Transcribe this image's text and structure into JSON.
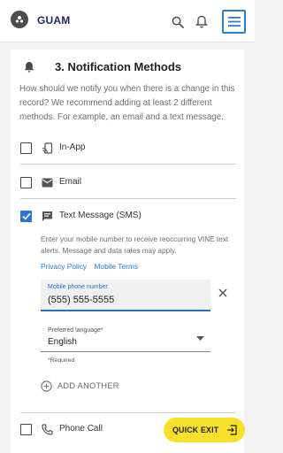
{
  "header": {
    "brand": "GUAM",
    "logo_icon": "vine-logo-icon",
    "search_icon": "search-icon",
    "notifications_icon": "bell-icon",
    "menu_icon": "menu-icon"
  },
  "section": {
    "title": "3. Notification Methods",
    "description": "How should we notify you when there is a change in this record? We recommend adding at least 2 different methods. For example, an email and a text message."
  },
  "methods": [
    {
      "label": "In-App",
      "icon": "cast-device-icon",
      "checked": false
    },
    {
      "label": "Email",
      "icon": "email-icon",
      "checked": false
    },
    {
      "label": "Text Message (SMS)",
      "icon": "message-icon",
      "checked": true
    },
    {
      "label": "Phone Call",
      "icon": "phone-icon",
      "checked": false
    }
  ],
  "sms": {
    "help": "Enter your mobile number to receive reoccurring VINE text alerts. Message and data rates may apply.",
    "privacy_link": "Privacy Policy",
    "terms_link": "Mobile Terms",
    "phone_label": "Mobile phone number",
    "phone_value": "(555) 555-5555",
    "language_label": "Preferred language*",
    "language_value": "English",
    "required_note": "*Required",
    "add_another": "ADD ANOTHER"
  },
  "quick_exit": {
    "label": "QUICK EXIT",
    "icon": "exit-icon"
  },
  "colors": {
    "accent": "#2b74d5",
    "quick_exit_bg": "#f7e12a",
    "brand_text": "#1f2a5a"
  }
}
